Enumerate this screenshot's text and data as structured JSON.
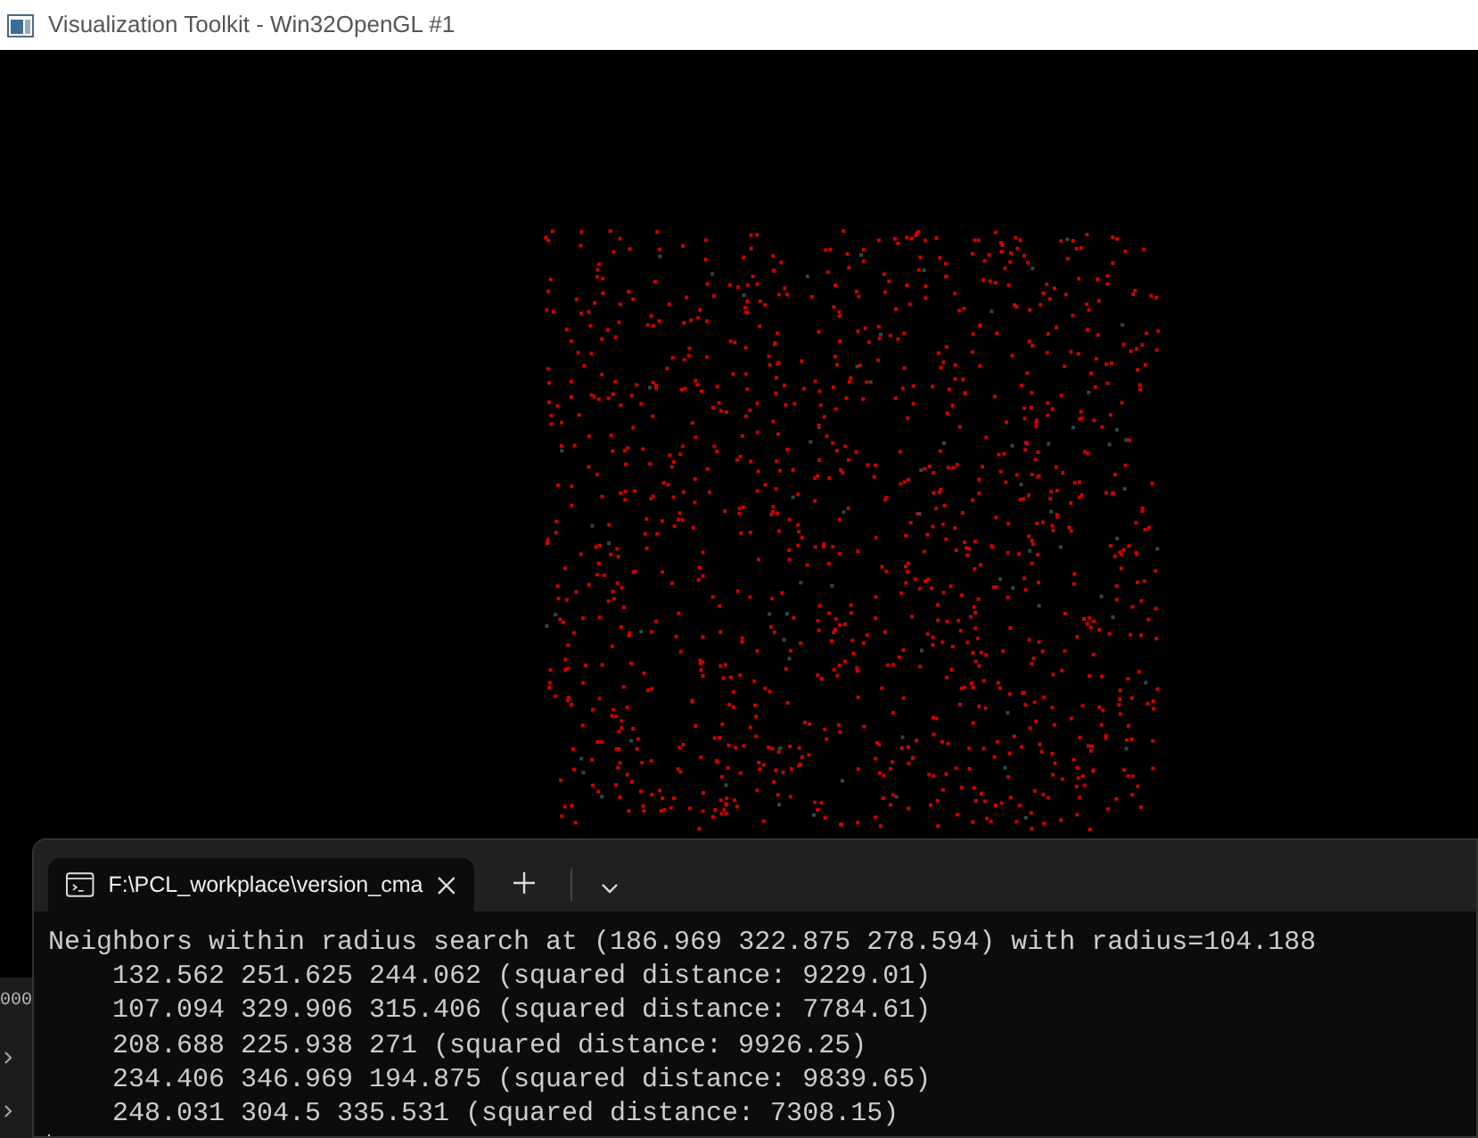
{
  "window": {
    "title": "Visualization Toolkit - Win32OpenGL #1"
  },
  "background_window": {
    "text": "000"
  },
  "terminal": {
    "tabs": [
      {
        "title": "F:\\PCL_workplace\\version_cma",
        "selected": true
      }
    ],
    "header": "Neighbors within radius search at (186.969 322.875 278.594) with radius=104.188",
    "results": [
      "132.562 251.625 244.062 (squared distance: 9229.01)",
      "107.094 329.906 315.406 (squared distance: 7784.61)",
      "208.688 225.938 271 (squared distance: 9926.25)",
      "234.406 346.969 194.875 (squared distance: 9839.65)",
      "248.031 304.5 335.531 (squared distance: 7308.15)"
    ]
  }
}
